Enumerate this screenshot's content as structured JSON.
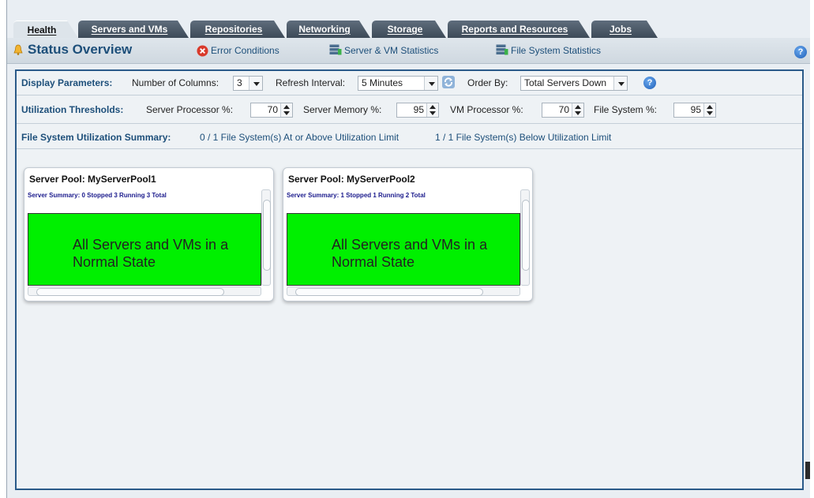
{
  "tabs": [
    {
      "label": "Health",
      "active": true
    },
    {
      "label": "Servers and VMs",
      "active": false
    },
    {
      "label": "Repositories",
      "active": false
    },
    {
      "label": "Networking",
      "active": false
    },
    {
      "label": "Storage",
      "active": false
    },
    {
      "label": "Reports and Resources",
      "active": false
    },
    {
      "label": "Jobs",
      "active": false
    }
  ],
  "header": {
    "title": "Status Overview",
    "links": [
      "Error Conditions",
      "Server & VM Statistics",
      "File System Statistics"
    ]
  },
  "display_parameters": {
    "label": "Display Parameters:",
    "columns_label": "Number of Columns:",
    "columns_value": "3",
    "refresh_label": "Refresh Interval:",
    "refresh_value": "5 Minutes",
    "order_label": "Order By:",
    "order_value": "Total Servers Down"
  },
  "thresholds": {
    "label": "Utilization Thresholds:",
    "server_processor_label": "Server Processor %:",
    "server_processor_value": "70",
    "server_memory_label": "Server Memory %:",
    "server_memory_value": "95",
    "vm_processor_label": "VM Processor %:",
    "vm_processor_value": "70",
    "file_system_label": "File System %:",
    "file_system_value": "95"
  },
  "fs_summary": {
    "label": "File System Utilization Summary:",
    "above": "0 / 1 File System(s) At or Above Utilization Limit",
    "below": "1 / 1 File System(s) Below Utilization Limit"
  },
  "pools": [
    {
      "title": "Server Pool: MyServerPool1",
      "summary": "Server Summary: 0 Stopped 3 Running 3 Total",
      "status": "All Servers and VMs in a Normal State",
      "status_color": "#00f000"
    },
    {
      "title": "Server Pool: MyServerPool2",
      "summary": "Server Summary: 1 Stopped 1 Running 2 Total",
      "status": "All Servers and VMs in a Normal State",
      "status_color": "#00f000"
    }
  ],
  "colors": {
    "accent": "#1d4f7a",
    "tab_bg": "#4a5766",
    "panel_border": "#2a5a89",
    "ok": "#00f000",
    "summary_text": "#1a1a8c"
  }
}
